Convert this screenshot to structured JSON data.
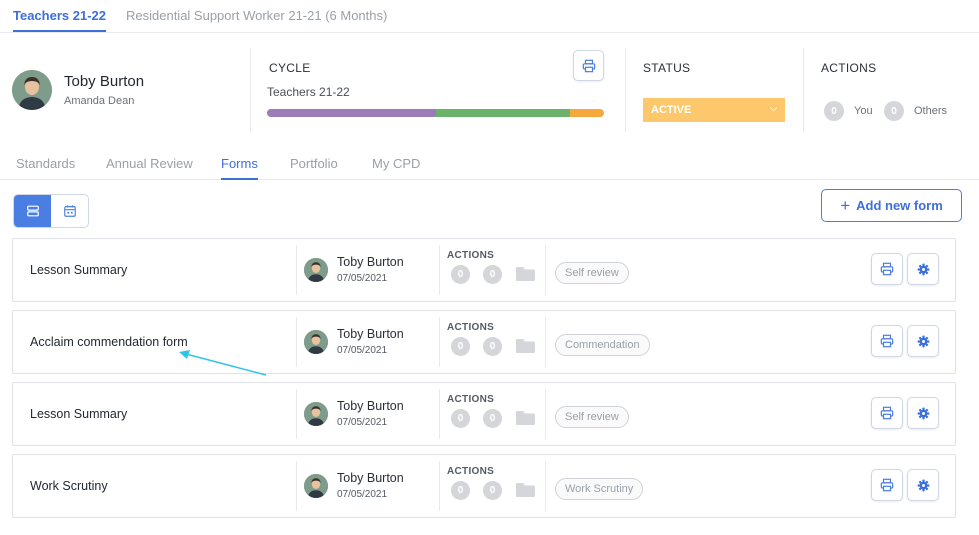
{
  "top_tabs": [
    {
      "label": "Teachers 21-22"
    },
    {
      "label": "Residential Support Worker 21-21 (6 Months)"
    }
  ],
  "profile": {
    "name": "Toby Burton",
    "subtitle": "Amanda Dean"
  },
  "cycle": {
    "title": "CYCLE",
    "name": "Teachers 21-22",
    "progress_segments": [
      {
        "color": "#9b7bb8",
        "fraction": 0.5
      },
      {
        "color": "#6bb36b",
        "fraction": 0.4
      },
      {
        "color": "#f5a93c",
        "fraction": 0.1
      }
    ]
  },
  "status": {
    "title": "STATUS",
    "value": "ACTIVE",
    "color": "#fdc86b"
  },
  "actions": {
    "title": "ACTIONS",
    "you_count": "0",
    "you_label": "You",
    "others_count": "0",
    "others_label": "Others"
  },
  "sub_tabs": [
    {
      "label": "Standards"
    },
    {
      "label": "Annual Review"
    },
    {
      "label": "Forms"
    },
    {
      "label": "Portfolio"
    },
    {
      "label": "My CPD"
    }
  ],
  "add_form_label": "Add new form",
  "forms": [
    {
      "title": "Lesson Summary",
      "person": "Toby Burton",
      "date": "07/05/2021",
      "actions_label": "ACTIONS",
      "count_a": "0",
      "count_b": "0",
      "badge": "Self review"
    },
    {
      "title": "Acclaim commendation form",
      "person": "Toby Burton",
      "date": "07/05/2021",
      "actions_label": "ACTIONS",
      "count_a": "0",
      "count_b": "0",
      "badge": "Commendation"
    },
    {
      "title": "Lesson Summary",
      "person": "Toby Burton",
      "date": "07/05/2021",
      "actions_label": "ACTIONS",
      "count_a": "0",
      "count_b": "0",
      "badge": "Self review"
    },
    {
      "title": "Work Scrutiny",
      "person": "Toby Burton",
      "date": "07/05/2021",
      "actions_label": "ACTIONS",
      "count_a": "0",
      "count_b": "0",
      "badge": "Work Scrutiny"
    }
  ],
  "colors": {
    "accent": "#3d6fd9",
    "annotation_arrow": "#2ec4e6"
  },
  "icons": {
    "print": "print-icon",
    "settings": "gear-icon",
    "list_view": "list-view-icon",
    "calendar_view": "calendar-icon",
    "folder": "folder-icon",
    "add": "plus-icon",
    "status_dropdown": "chevron-down-icon"
  }
}
